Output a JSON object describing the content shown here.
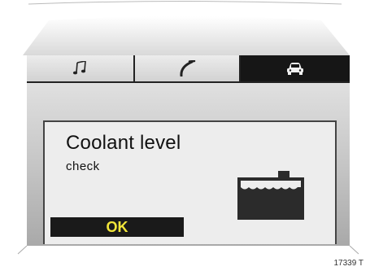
{
  "tabs": [
    {
      "icon": "music-note-icon",
      "active": false
    },
    {
      "icon": "phone-handset-icon",
      "active": false
    },
    {
      "icon": "car-icon",
      "active": true
    }
  ],
  "message": {
    "title": "Coolant level",
    "subtitle": "check",
    "icon": "coolant-tank-icon"
  },
  "actions": {
    "ok_label": "OK"
  },
  "reference": "17339 T",
  "colors": {
    "active_tab": "#161616",
    "button_bg": "#1a1a1a",
    "button_text": "#f2e63a"
  }
}
